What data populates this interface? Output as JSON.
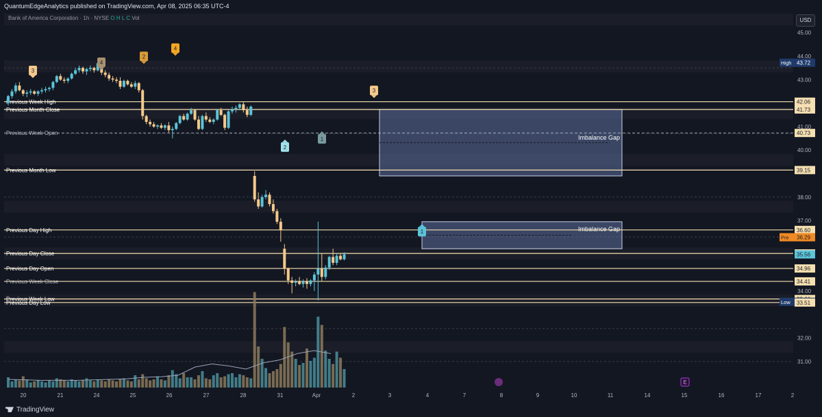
{
  "header": {
    "publisher_line": "QuantumEdgeAnalytics published on TradingView.com, Apr 08, 2025 06:35 UTC-4",
    "symbol": "Bank of America Corporation · 1h · NYSE",
    "ohlc_labels": [
      "O",
      "H",
      "L",
      "C"
    ],
    "volume_label": "Vol"
  },
  "currency": "USD",
  "footer": {
    "brand": "TradingView"
  },
  "colors": {
    "background": "#131722",
    "up": "#5bc4d8",
    "down": "#f5c98a",
    "level_line": "#f5dfb0",
    "zone_fill": "#5b6d9a",
    "label_dark": "#1c1f2b"
  },
  "chart_data": {
    "type": "candlestick",
    "symbol": "BAC",
    "interval": "1h",
    "ylim": [
      30.5,
      45.3
    ],
    "y_ticks": [
      31.0,
      32.0,
      34.0,
      35.0,
      37.0,
      38.0,
      40.0,
      41.0,
      43.0,
      44.0,
      45.0
    ],
    "x_tick_labels": [
      "20",
      "21",
      "24",
      "25",
      "26",
      "27",
      "28",
      "31",
      "Apr",
      "2",
      "3",
      "4",
      "7",
      "8",
      "9",
      "10",
      "11",
      "14",
      "15",
      "16",
      "17",
      "2"
    ],
    "candles": [
      [
        42.0,
        42.35,
        41.9,
        42.3
      ],
      [
        42.3,
        42.6,
        42.2,
        42.5
      ],
      [
        42.5,
        42.85,
        42.4,
        42.75
      ],
      [
        42.75,
        42.9,
        42.5,
        42.55
      ],
      [
        42.55,
        42.6,
        42.3,
        42.4
      ],
      [
        42.4,
        42.55,
        42.25,
        42.45
      ],
      [
        42.45,
        42.6,
        42.35,
        42.5
      ],
      [
        42.5,
        42.55,
        42.35,
        42.4
      ],
      [
        42.4,
        42.55,
        42.3,
        42.5
      ],
      [
        42.5,
        42.65,
        42.4,
        42.55
      ],
      [
        42.55,
        42.7,
        42.45,
        42.6
      ],
      [
        42.6,
        42.7,
        42.5,
        42.65
      ],
      [
        42.65,
        42.95,
        42.55,
        42.9
      ],
      [
        42.9,
        43.2,
        42.85,
        43.15
      ],
      [
        43.15,
        43.25,
        42.95,
        43.0
      ],
      [
        43.0,
        43.1,
        42.85,
        42.95
      ],
      [
        42.95,
        43.1,
        42.85,
        43.05
      ],
      [
        43.05,
        43.3,
        43.0,
        43.25
      ],
      [
        43.25,
        43.5,
        43.2,
        43.4
      ],
      [
        43.4,
        43.6,
        43.3,
        43.5
      ],
      [
        43.5,
        43.55,
        43.25,
        43.35
      ],
      [
        43.35,
        43.5,
        43.2,
        43.45
      ],
      [
        43.45,
        43.6,
        43.35,
        43.5
      ],
      [
        43.5,
        43.55,
        43.3,
        43.4
      ],
      [
        43.4,
        43.75,
        43.35,
        43.7
      ],
      [
        43.7,
        43.72,
        43.2,
        43.3
      ],
      [
        43.3,
        43.4,
        43.1,
        43.2
      ],
      [
        43.2,
        43.3,
        42.95,
        43.05
      ],
      [
        43.05,
        43.15,
        42.9,
        43.0
      ],
      [
        43.0,
        43.1,
        42.85,
        42.95
      ],
      [
        42.95,
        43.1,
        42.6,
        42.7
      ],
      [
        42.7,
        43.0,
        42.65,
        42.95
      ],
      [
        42.95,
        43.0,
        42.75,
        42.8
      ],
      [
        42.8,
        42.9,
        42.65,
        42.7
      ],
      [
        42.7,
        42.95,
        42.6,
        42.85
      ],
      [
        42.85,
        42.9,
        42.45,
        42.55
      ],
      [
        42.55,
        42.6,
        41.3,
        41.45
      ],
      [
        41.45,
        41.5,
        41.1,
        41.2
      ],
      [
        41.2,
        41.3,
        41.0,
        41.1
      ],
      [
        41.1,
        41.2,
        40.95,
        41.0
      ],
      [
        41.0,
        41.1,
        40.9,
        41.05
      ],
      [
        41.05,
        41.15,
        40.9,
        40.95
      ],
      [
        40.95,
        41.1,
        40.85,
        41.05
      ],
      [
        41.05,
        41.2,
        40.75,
        40.85
      ],
      [
        40.85,
        41.0,
        40.5,
        40.9
      ],
      [
        40.9,
        41.2,
        40.85,
        41.15
      ],
      [
        41.15,
        41.5,
        41.1,
        41.45
      ],
      [
        41.45,
        41.55,
        41.25,
        41.3
      ],
      [
        41.3,
        41.6,
        41.25,
        41.55
      ],
      [
        41.55,
        41.8,
        41.5,
        41.7
      ],
      [
        41.7,
        41.75,
        41.25,
        41.3
      ],
      [
        41.3,
        41.45,
        40.85,
        40.9
      ],
      [
        40.9,
        41.5,
        40.85,
        41.45
      ],
      [
        41.45,
        41.6,
        41.2,
        41.3
      ],
      [
        41.3,
        41.4,
        41.15,
        41.2
      ],
      [
        41.2,
        41.35,
        41.1,
        41.3
      ],
      [
        41.3,
        41.75,
        41.25,
        41.7
      ],
      [
        41.7,
        41.8,
        41.45,
        41.5
      ],
      [
        41.5,
        41.55,
        40.85,
        40.95
      ],
      [
        40.95,
        41.7,
        40.9,
        41.65
      ],
      [
        41.65,
        41.85,
        41.55,
        41.75
      ],
      [
        41.75,
        41.9,
        41.6,
        41.8
      ],
      [
        41.8,
        42.0,
        41.7,
        41.95
      ],
      [
        41.95,
        42.05,
        41.6,
        41.7
      ],
      [
        41.7,
        41.85,
        41.4,
        41.5
      ],
      [
        41.5,
        41.9,
        41.45,
        41.85
      ],
      [
        38.9,
        39.1,
        37.8,
        37.9
      ],
      [
        37.9,
        38.2,
        37.5,
        37.6
      ],
      [
        37.6,
        38.1,
        37.55,
        38.0
      ],
      [
        38.0,
        38.3,
        37.9,
        38.1
      ],
      [
        38.1,
        38.2,
        37.6,
        37.7
      ],
      [
        37.7,
        37.9,
        37.3,
        37.4
      ],
      [
        37.4,
        37.5,
        36.85,
        36.95
      ],
      [
        36.95,
        37.1,
        36.1,
        36.6
      ],
      [
        35.8,
        36.0,
        34.7,
        34.95
      ],
      [
        34.95,
        35.0,
        34.3,
        34.45
      ],
      [
        34.45,
        34.6,
        33.9,
        34.35
      ],
      [
        34.35,
        34.5,
        34.2,
        34.4
      ],
      [
        34.4,
        34.6,
        34.25,
        34.3
      ],
      [
        34.3,
        34.5,
        34.15,
        34.4
      ],
      [
        34.4,
        34.55,
        34.1,
        34.3
      ],
      [
        34.3,
        34.5,
        34.2,
        34.45
      ],
      [
        34.45,
        34.8,
        34.0,
        34.7
      ],
      [
        34.7,
        36.95,
        33.6,
        34.95
      ],
      [
        34.95,
        35.6,
        34.4,
        34.6
      ],
      [
        34.6,
        35.1,
        34.5,
        35.0
      ],
      [
        35.0,
        35.5,
        34.9,
        35.45
      ],
      [
        35.45,
        35.8,
        35.1,
        35.2
      ],
      [
        35.2,
        35.6,
        35.1,
        35.5
      ],
      [
        35.5,
        35.6,
        35.3,
        35.35
      ],
      [
        35.35,
        35.65,
        35.3,
        35.56
      ]
    ],
    "volumes": [
      1,
      0.6,
      0.8,
      0.7,
      1.1,
      0.8,
      0.5,
      0.6,
      0.7,
      0.6,
      0.5,
      0.7,
      0.6,
      0.9,
      0.8,
      0.7,
      0.6,
      0.8,
      0.7,
      0.6,
      0.7,
      0.9,
      0.7,
      0.6,
      0.8,
      0.7,
      0.6,
      0.8,
      0.7,
      0.6,
      0.8,
      0.9,
      0.7,
      0.6,
      1.2,
      0.8,
      1.3,
      0.9,
      0.7,
      0.8,
      1.1,
      0.8,
      0.7,
      1.2,
      1.7,
      1.3,
      0.9,
      1.4,
      1.0,
      1.0,
      0.8,
      1.2,
      1.6,
      0.9,
      0.8,
      1.2,
      1.4,
      1.0,
      1.1,
      1.3,
      1.4,
      1.0,
      1.3,
      1.2,
      1.0,
      0.9,
      9.3,
      4.0,
      2.8,
      1.9,
      1.4,
      1.6,
      1.8,
      2.3,
      5.9,
      4.4,
      3.5,
      2.8,
      2.2,
      2.4,
      3.8,
      2.6,
      2.9,
      6.9,
      6.1,
      3.6,
      2.8,
      2.3,
      3.5,
      2.9,
      1.8
    ],
    "volume_sma": [
      0.8,
      0.75,
      0.7,
      0.72,
      0.7,
      0.75,
      0.8,
      0.85,
      1.0,
      1.05,
      1.2,
      2.0,
      2.3,
      2.1,
      1.8,
      2.4,
      2.7,
      3.3,
      3.6,
      3.3
    ],
    "price_levels": [
      {
        "label": "Previous Week High",
        "price": 42.06
      },
      {
        "label": "Previous Month Close",
        "price": 41.73
      },
      {
        "label": "Previous Week Open",
        "price": 40.73
      },
      {
        "label": "Previous Month Low",
        "price": 39.15
      },
      {
        "label": "Previous Day High",
        "price": 36.6
      },
      {
        "label": "Previous Day Close",
        "price": 35.6
      },
      {
        "label": "Previous Day Open",
        "price": 34.96
      },
      {
        "label": "Previous Week Close",
        "price": 34.41
      },
      {
        "label": "Previous Week Low",
        "price": 33.66
      },
      {
        "label": "Previous Day Low",
        "price": 33.51
      }
    ],
    "zones": [
      {
        "label": "Imbalance Gap",
        "top": 41.73,
        "bottom": 38.9
      },
      {
        "label": "Imbalance Gap",
        "top": 36.95,
        "bottom": 35.8
      }
    ],
    "axis_badges": [
      {
        "text": "45.00",
        "type": "tick"
      },
      {
        "text": "44.00",
        "type": "tick"
      },
      {
        "text": "High",
        "value": "43.72",
        "type": "high"
      },
      {
        "text": "43.00",
        "type": "tick"
      },
      {
        "text": "42.06",
        "type": "level"
      },
      {
        "text": "41.73",
        "type": "level"
      },
      {
        "text": "40.73",
        "type": "level"
      },
      {
        "text": "39.15",
        "type": "level"
      },
      {
        "text": "36.60",
        "type": "level"
      },
      {
        "text": "Pre",
        "value": "36.29",
        "type": "pre"
      },
      {
        "text": "35.60",
        "type": "level"
      },
      {
        "text": "35.56",
        "type": "last"
      },
      {
        "text": "34.96",
        "type": "level"
      },
      {
        "text": "34.41",
        "type": "level"
      },
      {
        "text": "33.66",
        "type": "level"
      },
      {
        "text": "Low",
        "value": "33.54",
        "type": "low"
      },
      {
        "text": "33.51",
        "type": "level"
      }
    ],
    "markers": [
      {
        "text": "3",
        "price": 42.95,
        "style": "down",
        "color": "#f5c98a"
      },
      {
        "text": "4",
        "price": 43.3,
        "style": "down",
        "color": "#a89070"
      },
      {
        "text": "2",
        "price": 43.55,
        "style": "down",
        "color": "#d99a3a"
      },
      {
        "text": "4",
        "price": 43.9,
        "style": "down",
        "color": "#f5a623"
      },
      {
        "text": "3",
        "price": 42.1,
        "style": "down",
        "color": "#f5c98a"
      },
      {
        "text": "2",
        "price": 40.45,
        "style": "up",
        "color": "#9fe1ea"
      },
      {
        "text": "1",
        "price": 40.8,
        "style": "up",
        "color": "#7a9a9e"
      },
      {
        "text": "1",
        "price": 36.85,
        "style": "up",
        "color": "#5bc4d8"
      }
    ],
    "bottom_badges": [
      "E"
    ]
  }
}
